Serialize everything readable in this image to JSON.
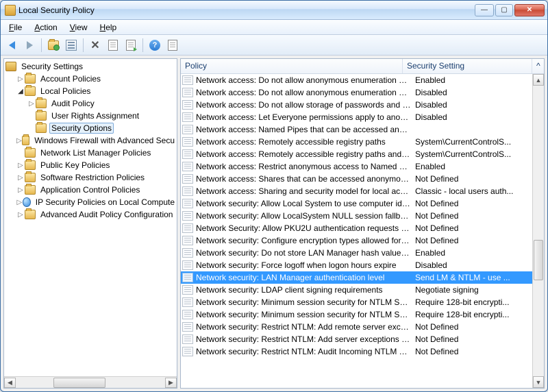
{
  "window": {
    "title": "Local Security Policy"
  },
  "menu": {
    "file": "File",
    "action": "Action",
    "view": "View",
    "help": "Help"
  },
  "tree": {
    "root": "Security Settings",
    "items": [
      {
        "label": "Account Policies",
        "indent": 1,
        "icon": "folder",
        "expander": "▷"
      },
      {
        "label": "Local Policies",
        "indent": 1,
        "icon": "folder",
        "expander": "◢"
      },
      {
        "label": "Audit Policy",
        "indent": 2,
        "icon": "folder",
        "expander": "▷"
      },
      {
        "label": "User Rights Assignment",
        "indent": 2,
        "icon": "folder",
        "expander": ""
      },
      {
        "label": "Security Options",
        "indent": 2,
        "icon": "folder",
        "expander": "",
        "selected": true
      },
      {
        "label": "Windows Firewall with Advanced Secu",
        "indent": 1,
        "icon": "folder",
        "expander": "▷"
      },
      {
        "label": "Network List Manager Policies",
        "indent": 1,
        "icon": "folder",
        "expander": ""
      },
      {
        "label": "Public Key Policies",
        "indent": 1,
        "icon": "folder",
        "expander": "▷"
      },
      {
        "label": "Software Restriction Policies",
        "indent": 1,
        "icon": "folder",
        "expander": "▷"
      },
      {
        "label": "Application Control Policies",
        "indent": 1,
        "icon": "folder",
        "expander": "▷"
      },
      {
        "label": "IP Security Policies on Local Compute",
        "indent": 1,
        "icon": "globe",
        "expander": "▷"
      },
      {
        "label": "Advanced Audit Policy Configuration",
        "indent": 1,
        "icon": "folder",
        "expander": "▷"
      }
    ]
  },
  "columns": {
    "policy": "Policy",
    "setting": "Security Setting"
  },
  "policies": [
    {
      "name": "Network access: Do not allow anonymous enumeration of S...",
      "setting": "Enabled"
    },
    {
      "name": "Network access: Do not allow anonymous enumeration of S...",
      "setting": "Disabled"
    },
    {
      "name": "Network access: Do not allow storage of passwords and cre...",
      "setting": "Disabled"
    },
    {
      "name": "Network access: Let Everyone permissions apply to anonym...",
      "setting": "Disabled"
    },
    {
      "name": "Network access: Named Pipes that can be accessed anonym...",
      "setting": ""
    },
    {
      "name": "Network access: Remotely accessible registry paths",
      "setting": "System\\CurrentControlS..."
    },
    {
      "name": "Network access: Remotely accessible registry paths and sub...",
      "setting": "System\\CurrentControlS..."
    },
    {
      "name": "Network access: Restrict anonymous access to Named Pipes ...",
      "setting": "Enabled"
    },
    {
      "name": "Network access: Shares that can be accessed anonymously",
      "setting": "Not Defined"
    },
    {
      "name": "Network access: Sharing and security model for local accou...",
      "setting": "Classic - local users auth..."
    },
    {
      "name": "Network security: Allow Local System to use computer ident...",
      "setting": "Not Defined"
    },
    {
      "name": "Network security: Allow LocalSystem NULL session fallback",
      "setting": "Not Defined"
    },
    {
      "name": "Network Security: Allow PKU2U authentication requests to t...",
      "setting": "Not Defined"
    },
    {
      "name": "Network security: Configure encryption types allowed for Ke...",
      "setting": "Not Defined"
    },
    {
      "name": "Network security: Do not store LAN Manager hash value on ...",
      "setting": "Enabled"
    },
    {
      "name": "Network security: Force logoff when logon hours expire",
      "setting": "Disabled"
    },
    {
      "name": "Network security: LAN Manager authentication level",
      "setting": "Send LM & NTLM - use ...",
      "selected": true
    },
    {
      "name": "Network security: LDAP client signing requirements",
      "setting": "Negotiate signing"
    },
    {
      "name": "Network security: Minimum session security for NTLM SSP ...",
      "setting": "Require 128-bit encrypti..."
    },
    {
      "name": "Network security: Minimum session security for NTLM SSP ...",
      "setting": "Require 128-bit encrypti..."
    },
    {
      "name": "Network security: Restrict NTLM: Add remote server excepti...",
      "setting": "Not Defined"
    },
    {
      "name": "Network security: Restrict NTLM: Add server exceptions in t...",
      "setting": "Not Defined"
    },
    {
      "name": "Network security: Restrict NTLM: Audit Incoming NTLM Tra...",
      "setting": "Not Defined"
    }
  ]
}
